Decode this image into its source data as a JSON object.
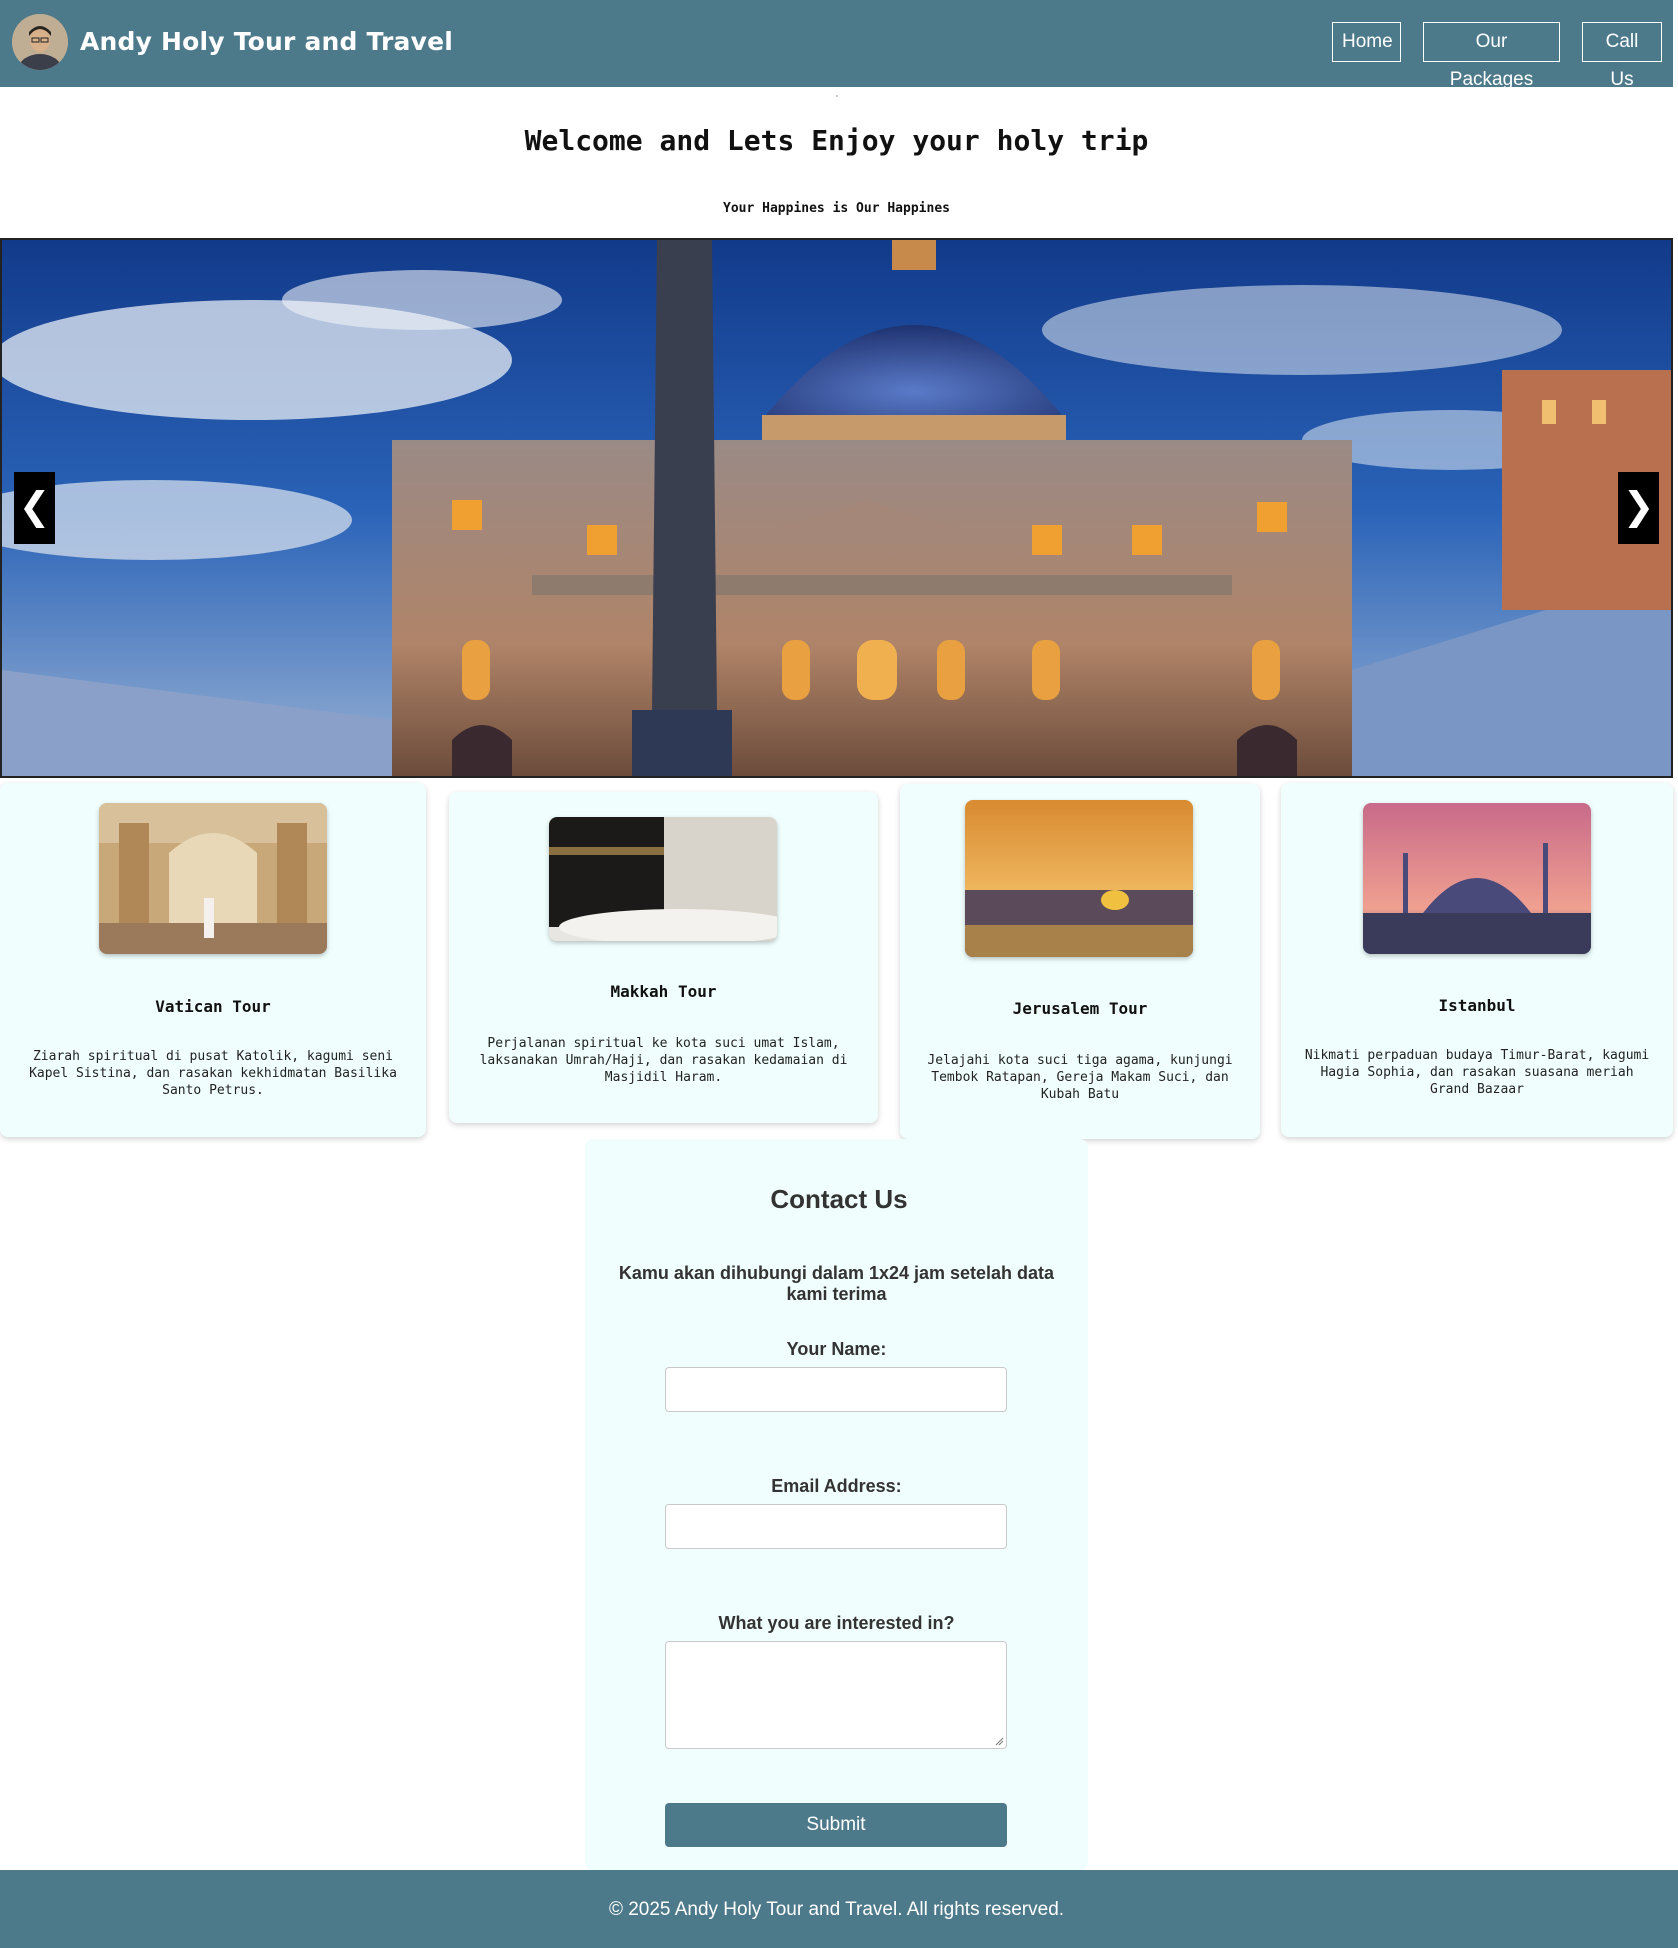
{
  "header": {
    "brand": "Andy Holy Tour and Travel",
    "nav": [
      "Home",
      "Our Packages",
      "Call Us"
    ],
    "color": "#4d7a8b"
  },
  "intro": {
    "title": "Welcome and Lets Enjoy your holy trip",
    "tagline": "Your Happines is Our Happines"
  },
  "carousel": {
    "prev": "❮",
    "next": "❯"
  },
  "cards": [
    {
      "title": "Vatican Tour",
      "desc": "Ziarah spiritual di pusat Katolik, kagumi seni Kapel Sistina, dan rasakan kekhidmatan Basilika Santo Petrus."
    },
    {
      "title": "Makkah Tour",
      "desc": "Perjalanan spiritual ke kota suci umat Islam, laksanakan Umrah/Haji, dan rasakan kedamaian di Masjidil Haram."
    },
    {
      "title": "Jerusalem Tour",
      "desc": "Jelajahi kota suci tiga agama, kunjungi Tembok Ratapan, Gereja Makam Suci, dan Kubah Batu"
    },
    {
      "title": "Istanbul",
      "desc": "Nikmati perpaduan budaya Timur-Barat, kagumi Hagia Sophia, dan rasakan suasana meriah Grand Bazaar"
    }
  ],
  "contact": {
    "title": "Contact Us",
    "subtitle": "Kamu akan dihubungi dalam 1x24 jam setelah data kami terima",
    "name_label": "Your Name:",
    "email_label": "Email Address:",
    "interest_label": "What you are interested in?",
    "submit": "Submit"
  },
  "footer": {
    "text": "© 2025 Andy Holy Tour and Travel. All rights reserved."
  }
}
